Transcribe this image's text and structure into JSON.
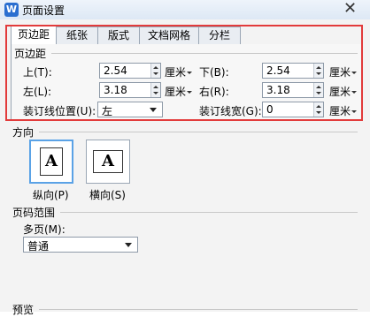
{
  "window": {
    "title": "页面设置",
    "app_icon": "W",
    "close": "✕"
  },
  "tabs": [
    {
      "label": "页边距",
      "active": true
    },
    {
      "label": "纸张"
    },
    {
      "label": "版式"
    },
    {
      "label": "文档网格"
    },
    {
      "label": "分栏"
    }
  ],
  "margins": {
    "section": "页边距",
    "top": {
      "label": "上(T):",
      "value": "2.54",
      "unit": "厘米"
    },
    "bottom": {
      "label": "下(B):",
      "value": "2.54",
      "unit": "厘米"
    },
    "left": {
      "label": "左(L):",
      "value": "3.18",
      "unit": "厘米"
    },
    "right": {
      "label": "右(R):",
      "value": "3.18",
      "unit": "厘米"
    },
    "gutter_pos": {
      "label": "装订线位置(U):",
      "value": "左"
    },
    "gutter": {
      "label": "装订线宽(G):",
      "value": "0",
      "unit": "厘米"
    }
  },
  "orientation": {
    "section": "方向",
    "glyph": "A",
    "portrait": {
      "label": "纵向(P)",
      "selected": true
    },
    "landscape": {
      "label": "横向(S)"
    }
  },
  "pages": {
    "section": "页码范围",
    "multiple_label": "多页(M):",
    "multiple_value": "普通"
  },
  "preview": {
    "section": "预览"
  },
  "colors": {
    "highlight": "#e23b3b",
    "selection": "#5aa2e6"
  }
}
